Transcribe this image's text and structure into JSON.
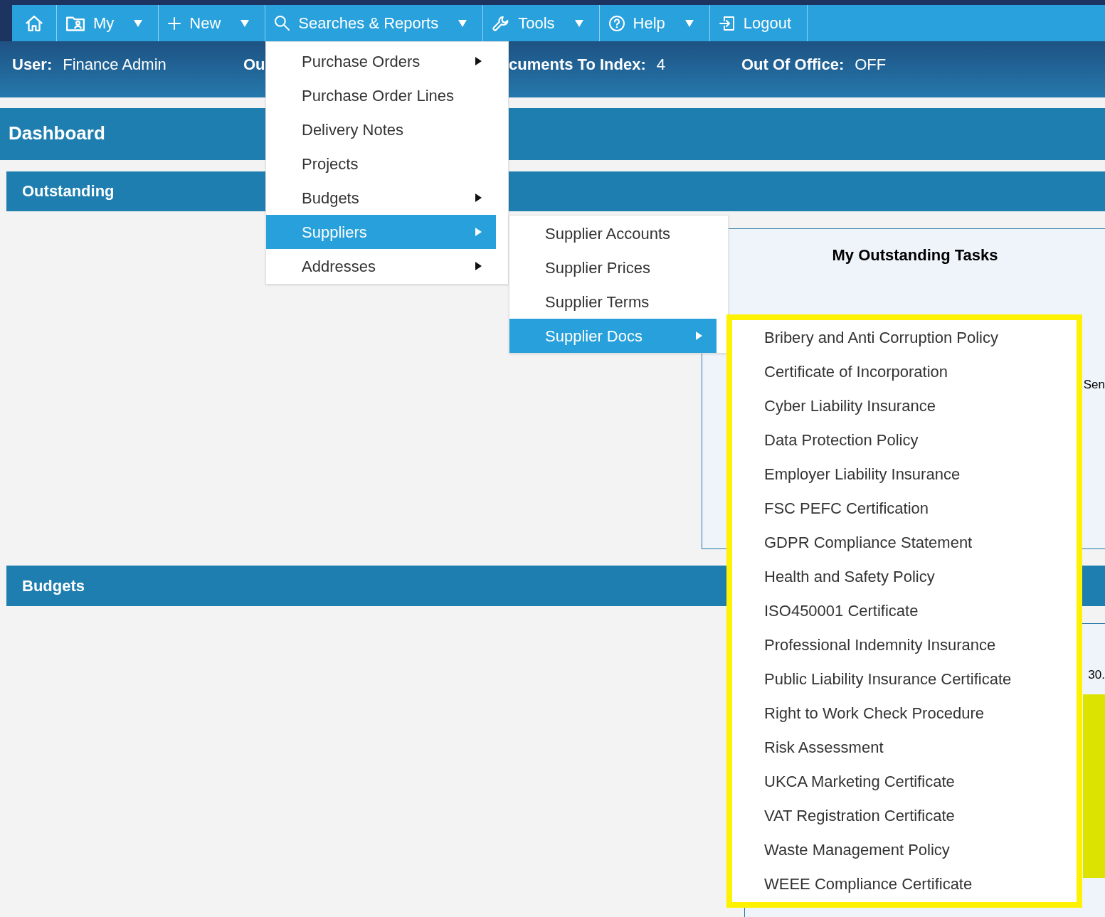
{
  "nav_bar": {
    "items": [
      {
        "has_menu": false
      },
      {
        "label": "My",
        "has_menu": true
      },
      {
        "label": "New",
        "has_menu": true
      },
      {
        "label": "Searches & Reports",
        "has_menu": true
      },
      {
        "label": "Tools",
        "has_menu": true
      },
      {
        "label": "Help",
        "has_menu": true
      },
      {
        "label": "Logout",
        "has_menu": false
      }
    ]
  },
  "user_bar": {
    "fields": [
      {
        "label": "User:",
        "value": "Finance Admin"
      },
      {
        "label": "Ou"
      },
      {
        "label": "cuments To Index:",
        "value": "4"
      },
      {
        "label": "Out Of Office:",
        "value": "OFF"
      }
    ]
  },
  "page_title": "Dashboard",
  "sections": [
    {
      "title": "Outstanding",
      "panel": {
        "kind": "tasks",
        "title": "My Outstanding Tasks",
        "partial_text": "Sen"
      }
    },
    {
      "title": "Budgets",
      "panel": {
        "kind": "chart",
        "partial_text": "30."
      }
    }
  ],
  "dropdown_menus": [
    {
      "highlighted": false,
      "items": [
        {
          "label": "Purchase Orders",
          "has_submenu": true,
          "selected": false
        },
        {
          "label": "Purchase Order Lines",
          "has_submenu": false,
          "selected": false
        },
        {
          "label": "Delivery Notes",
          "has_submenu": false,
          "selected": false
        },
        {
          "label": "Projects",
          "has_submenu": false,
          "selected": false
        },
        {
          "label": "Budgets",
          "has_submenu": true,
          "selected": false
        },
        {
          "label": "Suppliers",
          "has_submenu": true,
          "selected": true
        },
        {
          "label": "Addresses",
          "has_submenu": true,
          "selected": false
        }
      ]
    },
    {
      "highlighted": false,
      "items": [
        {
          "label": "Supplier Accounts",
          "has_submenu": false,
          "selected": false
        },
        {
          "label": "Supplier Prices",
          "has_submenu": false,
          "selected": false
        },
        {
          "label": "Supplier Terms",
          "has_submenu": false,
          "selected": false
        },
        {
          "label": "Supplier Docs",
          "has_submenu": true,
          "selected": true
        }
      ]
    },
    {
      "highlighted": true,
      "items": [
        {
          "label": "Bribery and Anti Corruption Policy",
          "has_submenu": false,
          "selected": false
        },
        {
          "label": "Certificate of Incorporation",
          "has_submenu": false,
          "selected": false
        },
        {
          "label": "Cyber Liability Insurance",
          "has_submenu": false,
          "selected": false
        },
        {
          "label": "Data Protection Policy",
          "has_submenu": false,
          "selected": false
        },
        {
          "label": "Employer Liability Insurance",
          "has_submenu": false,
          "selected": false
        },
        {
          "label": "FSC PEFC Certification",
          "has_submenu": false,
          "selected": false
        },
        {
          "label": "GDPR Compliance Statement",
          "has_submenu": false,
          "selected": false
        },
        {
          "label": "Health and Safety Policy",
          "has_submenu": false,
          "selected": false
        },
        {
          "label": "ISO450001 Certificate",
          "has_submenu": false,
          "selected": false
        },
        {
          "label": "Professional Indemnity Insurance",
          "has_submenu": false,
          "selected": false
        },
        {
          "label": "Public Liability Insurance Certificate",
          "has_submenu": false,
          "selected": false
        },
        {
          "label": "Right to Work Check Procedure",
          "has_submenu": false,
          "selected": false
        },
        {
          "label": "Risk Assessment",
          "has_submenu": false,
          "selected": false
        },
        {
          "label": "UKCA Marketing Certificate",
          "has_submenu": false,
          "selected": false
        },
        {
          "label": "VAT Registration Certificate",
          "has_submenu": false,
          "selected": false
        },
        {
          "label": "Waste Management Policy",
          "has_submenu": false,
          "selected": false
        },
        {
          "label": "WEEE Compliance Certificate",
          "has_submenu": false,
          "selected": false
        }
      ]
    }
  ]
}
